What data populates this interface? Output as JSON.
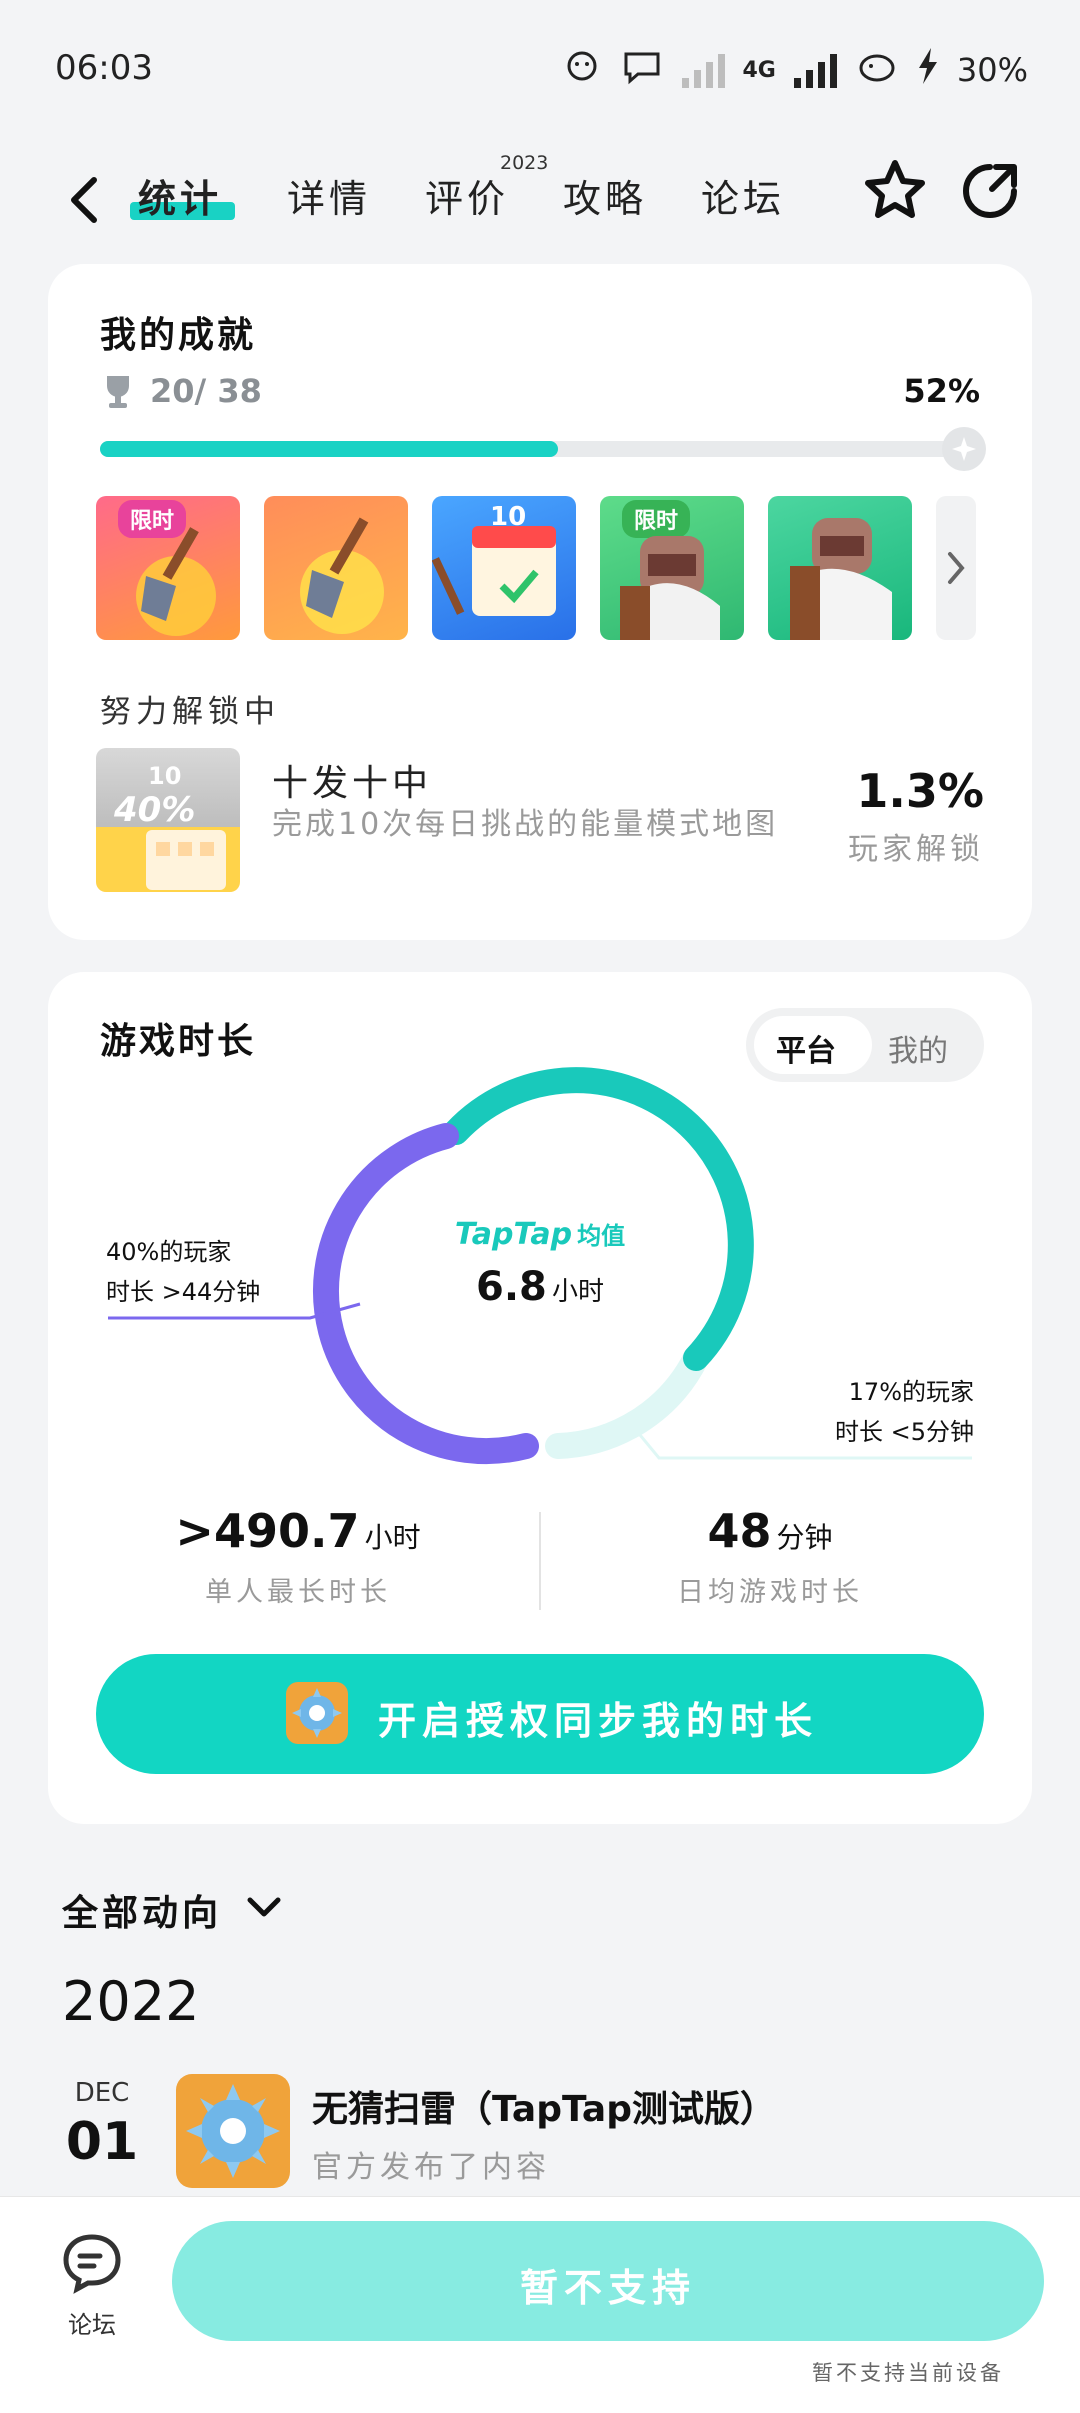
{
  "status_bar": {
    "time": "06:03",
    "network": "4G",
    "battery": "30%"
  },
  "header": {
    "tabs": [
      {
        "label": "统计",
        "active": true
      },
      {
        "label": "详情"
      },
      {
        "label": "评价",
        "badge": "2023"
      },
      {
        "label": "攻略"
      },
      {
        "label": "论坛"
      }
    ]
  },
  "achievements": {
    "title": "我的成就",
    "count": "20/ 38",
    "percent": "52%",
    "progress": 0.52,
    "badges": [
      {
        "label": "限时",
        "icon": "shovel-icon"
      },
      {
        "label": "",
        "icon": "shovel-icon"
      },
      {
        "label": "10",
        "icon": "calendar-icon"
      },
      {
        "label": "限时",
        "icon": "knight-icon"
      },
      {
        "label": "",
        "icon": "knight-icon"
      }
    ],
    "unlocking_title": "努力解锁中",
    "unlocking": {
      "badge_top": "10",
      "badge_pct": "40%",
      "name": "十发十中",
      "desc": "完成10次每日挑战的能量模式地图",
      "rate": "1.3%",
      "rate_label": "玩家解锁"
    }
  },
  "playtime": {
    "title": "游戏时长",
    "toggle_on": "平台",
    "toggle_off": "我的",
    "left_note_1": "40%的玩家",
    "left_note_2": "时长 >44分钟",
    "right_note_1": "17%的玩家",
    "right_note_2": "时长 <5分钟",
    "center_brand": "TapTap",
    "center_brand_suffix": "均值",
    "center_value": "6.8",
    "center_unit": "小时",
    "donut": {
      "long_pct": 40,
      "short_pct": 17,
      "mid_pct": 43
    },
    "max_value": ">490.7",
    "max_unit": "小时",
    "max_label": "单人最长时长",
    "daily_value": "48",
    "daily_unit": "分钟",
    "daily_label": "日均游戏时长",
    "cta": "开启授权同步我的时长"
  },
  "feed": {
    "filter": "全部动向",
    "year": "2022",
    "item": {
      "month": "DEC",
      "day": "01",
      "title": "无猜扫雷（TapTap测试版）",
      "subtitle": "官方发布了内容"
    }
  },
  "bottom": {
    "forum_label": "论坛",
    "button": "暂不支持",
    "note": "暂不支持当前设备"
  },
  "colors": {
    "accent": "#19d2c4",
    "purple": "#7b68ee",
    "light_teal": "#dff7f5"
  }
}
